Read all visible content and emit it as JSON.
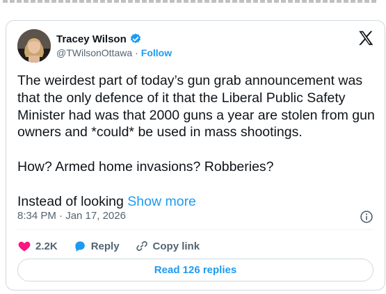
{
  "tweet": {
    "author": {
      "display_name": "Tracey Wilson",
      "handle": "@TWilsonOttawa",
      "separator": "·",
      "follow_label": "Follow",
      "verified": true
    },
    "body": {
      "paragraph1": "The weirdest part of today’s gun grab announcement was that the only defence of it that the Liberal Public Safety Minister had was that 2000 guns a year are stolen from gun owners and *could* be used in mass shootings.",
      "paragraph2": "How? Armed home invasions? Robberies?",
      "paragraph3": "Instead of looking",
      "show_more": "Show more"
    },
    "timestamp": "8:34 PM · Jan 17, 2026",
    "actions": {
      "likes": "2.2K",
      "reply_label": "Reply",
      "copy_link_label": "Copy link"
    },
    "read_replies_label": "Read 126 replies"
  },
  "colors": {
    "accent": "#1d9bf0",
    "like": "#f91880",
    "text": "#0f1419",
    "secondary_text": "#536471",
    "border": "#cfd9de"
  },
  "icons": [
    "verified-badge-icon",
    "x-logo-icon",
    "info-icon",
    "heart-icon",
    "reply-bubble-icon",
    "link-icon"
  ]
}
